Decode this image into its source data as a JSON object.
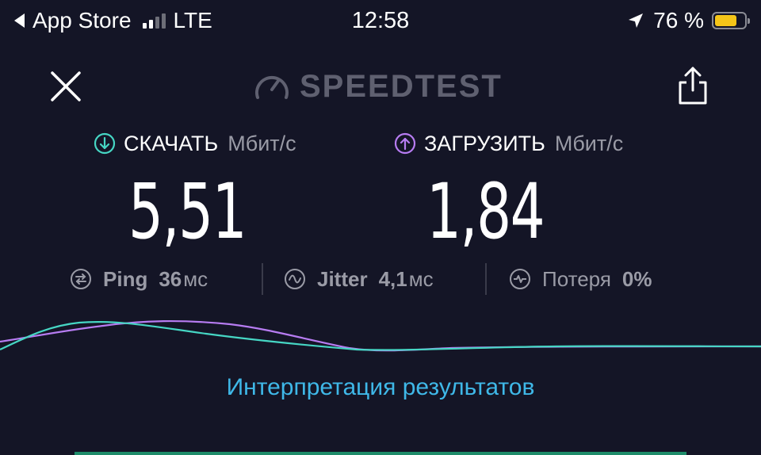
{
  "status_bar": {
    "back_app": "App Store",
    "network": "LTE",
    "time": "12:58",
    "battery_text": "76 %",
    "battery_level": 0.76,
    "battery_color": "#f5c518"
  },
  "header": {
    "close_icon": "close-icon",
    "logo_text": "SPEEDTEST",
    "share_icon": "share-icon"
  },
  "download": {
    "label": "СКАЧАТЬ",
    "unit": "Мбит/с",
    "value": "5,51",
    "color": "#46d6c4"
  },
  "upload": {
    "label": "ЗАГРУЗИТЬ",
    "unit": "Мбит/с",
    "value": "1,84",
    "color": "#b77cf2"
  },
  "stats": {
    "ping": {
      "label": "Ping",
      "value": "36",
      "unit": "мс"
    },
    "jitter": {
      "label": "Jitter",
      "value": "4,1",
      "unit": "мс"
    },
    "loss": {
      "label": "Потеря",
      "value": "0%"
    }
  },
  "results_link": "Интерпретация результатов",
  "colors": {
    "background": "#141526",
    "link": "#3fb8e8",
    "muted": "#9a9ba6"
  }
}
